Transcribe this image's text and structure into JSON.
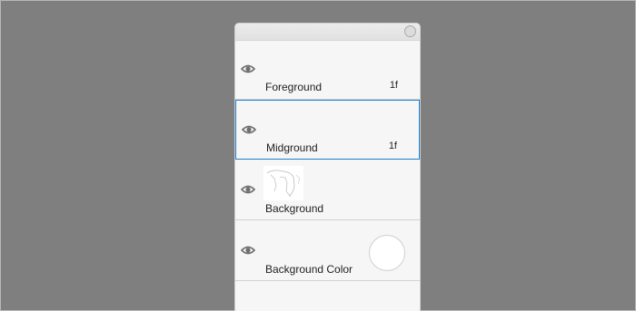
{
  "layers": [
    {
      "name": "Foreground",
      "frames": "1f",
      "selected": false,
      "visible": true
    },
    {
      "name": "Midground",
      "frames": "1f",
      "selected": true,
      "visible": true
    },
    {
      "name": "Background",
      "frames": "",
      "selected": false,
      "visible": true
    },
    {
      "name": "Background Color",
      "frames": "",
      "selected": false,
      "visible": true
    }
  ],
  "colors": {
    "backdrop": "#7f7f7f",
    "panel": "#f6f6f6",
    "selection_border": "#1d7fd0",
    "background_color_swatch": "#ffffff"
  }
}
